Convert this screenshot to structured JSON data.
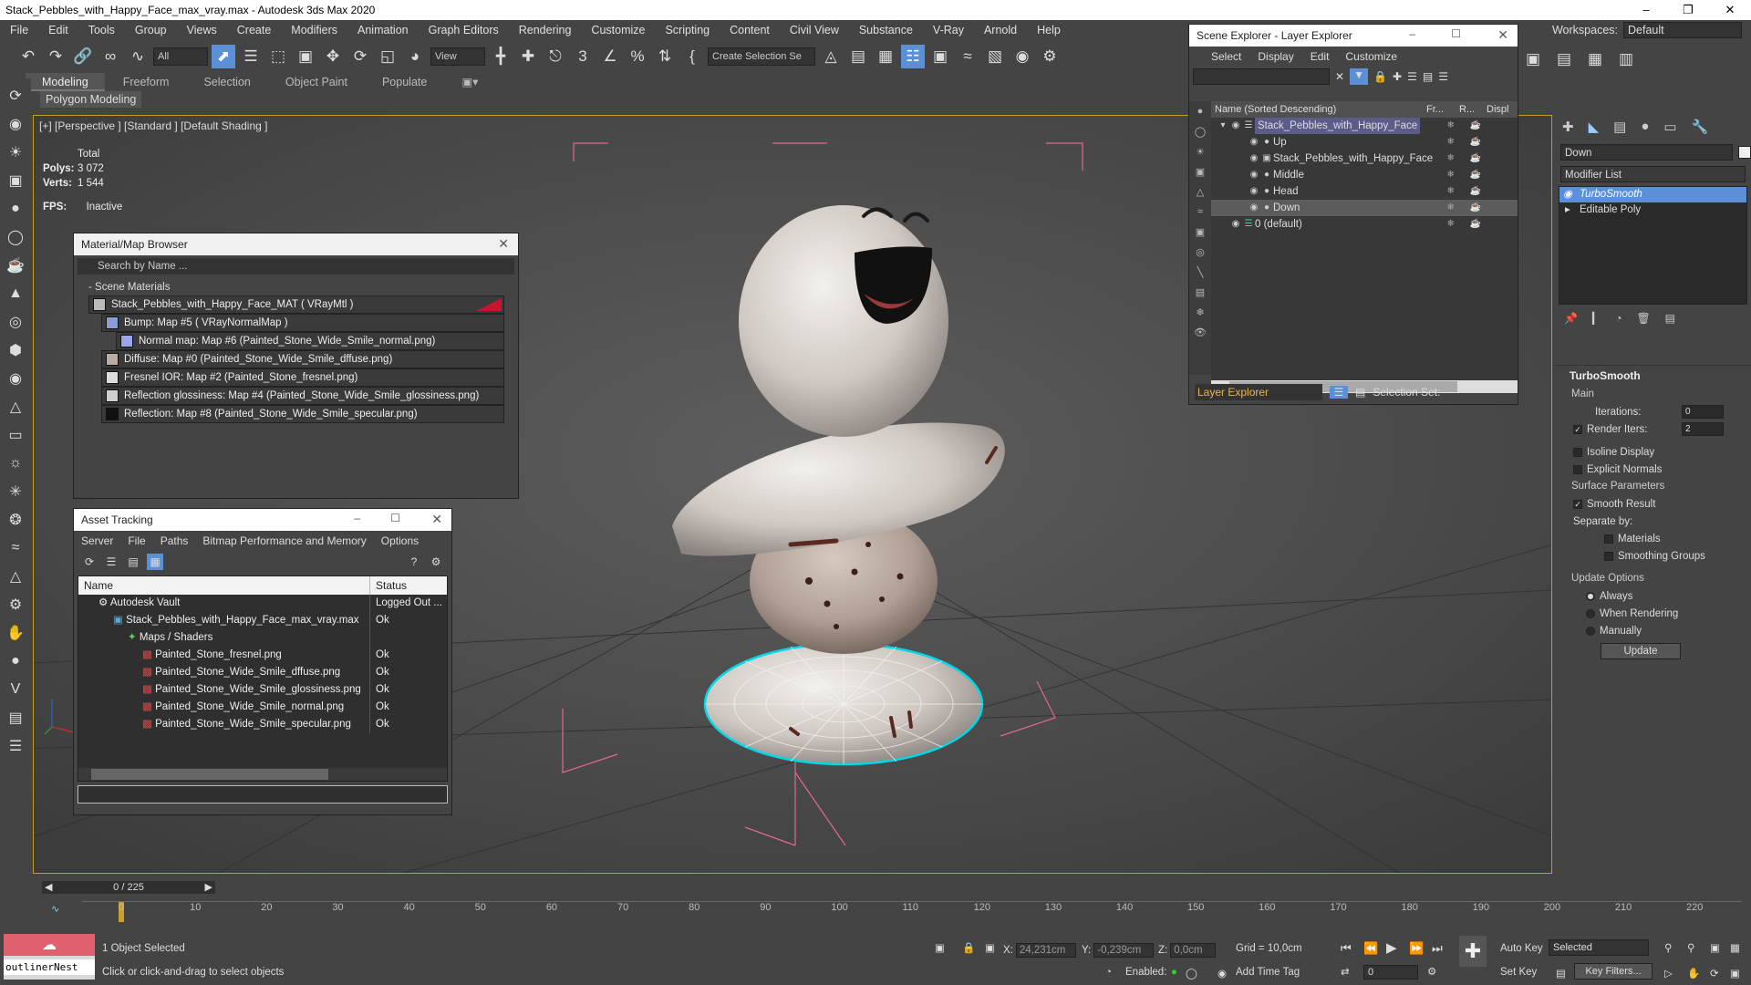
{
  "window": {
    "title": "Stack_Pebbles_with_Happy_Face_max_vray.max - Autodesk 3ds Max 2020"
  },
  "menu": [
    "File",
    "Edit",
    "Tools",
    "Group",
    "Views",
    "Create",
    "Modifiers",
    "Animation",
    "Graph Editors",
    "Rendering",
    "Customize",
    "Scripting",
    "Content",
    "Civil View",
    "Substance",
    "V-Ray",
    "Arnold",
    "Help"
  ],
  "workspaces": {
    "label": "Workspaces:",
    "value": "Default"
  },
  "toolbar": {
    "filter": "All",
    "view": "View",
    "selection_set": "Create Selection Se"
  },
  "ribbon": {
    "tabs": [
      "Modeling",
      "Freeform",
      "Selection",
      "Object Paint",
      "Populate"
    ],
    "sub": "Polygon Modeling"
  },
  "viewport": {
    "label": "[+] [Perspective ] [Standard ] [Default Shading ]",
    "stats_total": "Total",
    "polys_label": "Polys:",
    "polys": "3 072",
    "verts_label": "Verts:",
    "verts": "1 544",
    "fps_label": "FPS:",
    "fps": "Inactive"
  },
  "material_browser": {
    "title": "Material/Map Browser",
    "search": "Search by Name ...",
    "section": "- Scene Materials",
    "items": [
      "Stack_Pebbles_with_Happy_Face_MAT ( VRayMtl )",
      "Bump: Map #5 ( VRayNormalMap )",
      "Normal map: Map #6 (Painted_Stone_Wide_Smile_normal.png)",
      "Diffuse: Map #0 (Painted_Stone_Wide_Smile_dffuse.png)",
      "Fresnel IOR: Map #2 (Painted_Stone_fresnel.png)",
      "Reflection glossiness: Map #4 (Painted_Stone_Wide_Smile_glossiness.png)",
      "Reflection: Map #8 (Painted_Stone_Wide_Smile_specular.png)"
    ]
  },
  "asset_tracking": {
    "title": "Asset Tracking",
    "menu": [
      "Server",
      "File",
      "Paths",
      "Bitmap Performance and Memory",
      "Options"
    ],
    "col_name": "Name",
    "col_status": "Status",
    "rows": [
      {
        "name": "Autodesk Vault",
        "status": "Logged Out ..."
      },
      {
        "name": "Stack_Pebbles_with_Happy_Face_max_vray.max",
        "status": "Ok"
      },
      {
        "name": "Maps / Shaders",
        "status": ""
      },
      {
        "name": "Painted_Stone_fresnel.png",
        "status": "Ok"
      },
      {
        "name": "Painted_Stone_Wide_Smile_dffuse.png",
        "status": "Ok"
      },
      {
        "name": "Painted_Stone_Wide_Smile_glossiness.png",
        "status": "Ok"
      },
      {
        "name": "Painted_Stone_Wide_Smile_normal.png",
        "status": "Ok"
      },
      {
        "name": "Painted_Stone_Wide_Smile_specular.png",
        "status": "Ok"
      }
    ]
  },
  "scene_explorer": {
    "title": "Scene Explorer - Layer Explorer",
    "menu": [
      "Select",
      "Display",
      "Edit",
      "Customize"
    ],
    "col_name": "Name (Sorted Descending)",
    "col_fr": "Fr...",
    "col_r": "R...",
    "col_disp": "Displ",
    "rows": [
      "Stack_Pebbles_with_Happy_Face",
      "Up",
      "Stack_Pebbles_with_Happy_Face",
      "Middle",
      "Head",
      "Down",
      "0 (default)"
    ],
    "footer_left": "Layer Explorer",
    "footer_right": "Selection Set:"
  },
  "command_panel": {
    "object_name": "Down",
    "modifier_list": "Modifier List",
    "stack": [
      "TurboSmooth",
      "Editable Poly"
    ],
    "rollout": "TurboSmooth",
    "main": "Main",
    "iterations_label": "Iterations:",
    "iterations": "0",
    "render_iters_label": "Render Iters:",
    "render_iters": "2",
    "isoline": "Isoline Display",
    "explicit": "Explicit Normals",
    "surface": "Surface Parameters",
    "smooth_result": "Smooth Result",
    "separate": "Separate by:",
    "materials": "Materials",
    "smoothing_groups": "Smoothing Groups",
    "update_options": "Update Options",
    "always": "Always",
    "when_rendering": "When Rendering",
    "manually": "Manually",
    "update": "Update"
  },
  "timeline": {
    "frame": "0 / 225",
    "ticks": [
      "0",
      "10",
      "20",
      "30",
      "40",
      "50",
      "60",
      "70",
      "80",
      "90",
      "100",
      "110",
      "120",
      "130",
      "140",
      "150",
      "160",
      "170",
      "180",
      "190",
      "200",
      "210",
      "220"
    ]
  },
  "status": {
    "selected": "1 Object Selected",
    "hint": "Click or click-and-drag to select objects",
    "x_label": "X:",
    "x": "24,231cm",
    "y_label": "Y:",
    "y": "-0,239cm",
    "z_label": "Z:",
    "z": "0,0cm",
    "grid": "Grid = 10,0cm",
    "enabled": "Enabled:",
    "add_time_tag": "Add Time Tag",
    "auto_key": "Auto Key",
    "set_key": "Set Key",
    "selected_dd": "Selected",
    "key_filters": "Key Filters...",
    "frame_val": "0",
    "script": "outlinerNest"
  }
}
